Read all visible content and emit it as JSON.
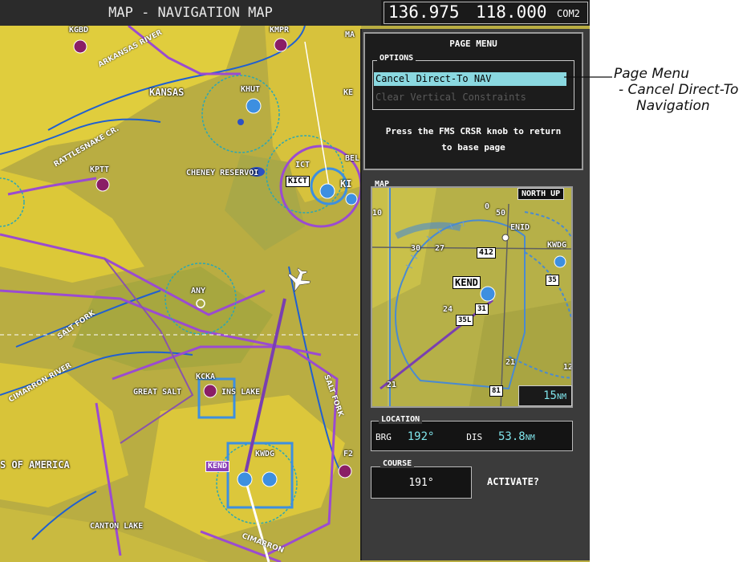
{
  "header": {
    "title": "MAP - NAVIGATION MAP",
    "freq_active": "136.975",
    "freq_standby": "118.000",
    "com_label": "COM2"
  },
  "map_labels": {
    "kgbd": "KGBD",
    "kmpr": "KMPR",
    "ma": "MA",
    "kansas": "KANSAS",
    "khut": "KHUT",
    "ke": "KE",
    "bel": "BEL",
    "kptt": "KPTT",
    "cheney": "CHENEY RESERVOI",
    "ict": "ICT",
    "kict": "KICT",
    "ki": "KI",
    "any": "ANY",
    "kcka": "KCKA",
    "great_salt": "GREAT SALT",
    "plains_lake": "INS LAKE",
    "kwdg": "KWDG",
    "kend": "KEND",
    "f2": "F2",
    "america": "S OF AMERICA",
    "canton": "CANTON LAKE",
    "river1": "ARKANSAS RIVER",
    "river2": "RATTLESNAKE CR.",
    "river3": "SALT FORK",
    "river4": "CIMARRON RIVER",
    "river5": "SALT FORK",
    "river6": "CIMARRON"
  },
  "page_menu": {
    "title": "PAGE MENU",
    "options_label": "OPTIONS",
    "items": [
      {
        "label": "Cancel Direct-To NAV",
        "state": "selected"
      },
      {
        "label": "Clear Vertical Constraints",
        "state": "disabled"
      }
    ],
    "instruction_line1": "Press the FMS CRSR knob to return",
    "instruction_line2": "to base page"
  },
  "inset_map": {
    "tag": "MAP",
    "orientation": "NORTH UP",
    "range_value": "15",
    "range_unit": "NM",
    "labels": {
      "kend": "KEND",
      "enid": "ENID",
      "kwdg": "KWDG",
      "r27": "27",
      "r24": "24",
      "r31": "31",
      "r35l": "35L",
      "r35": "35",
      "r12": "12",
      "r21a": "21",
      "r21b": "21",
      "r30": "30",
      "hw412": "412",
      "hw81": "81",
      "r0": "0",
      "r50": "50",
      "r10": "10"
    }
  },
  "location": {
    "tag": "LOCATION",
    "brg_label": "BRG",
    "brg_value": "192°",
    "dis_label": "DIS",
    "dis_value": "53.8",
    "dis_unit": "NM"
  },
  "course": {
    "tag": "COURSE",
    "value": "191°",
    "activate_label": "ACTIVATE?"
  },
  "annotation": {
    "line1": "Page Menu",
    "line2": "- Cancel Direct-To",
    "line3": "Navigation"
  },
  "colors": {
    "highlight": "#8ad8e0",
    "cyan_text": "#7fe3ea",
    "airspace_purple": "#9b4bd0",
    "class_d_blue": "#3d8fe0",
    "terrain_yellow": "#d9c43e"
  }
}
